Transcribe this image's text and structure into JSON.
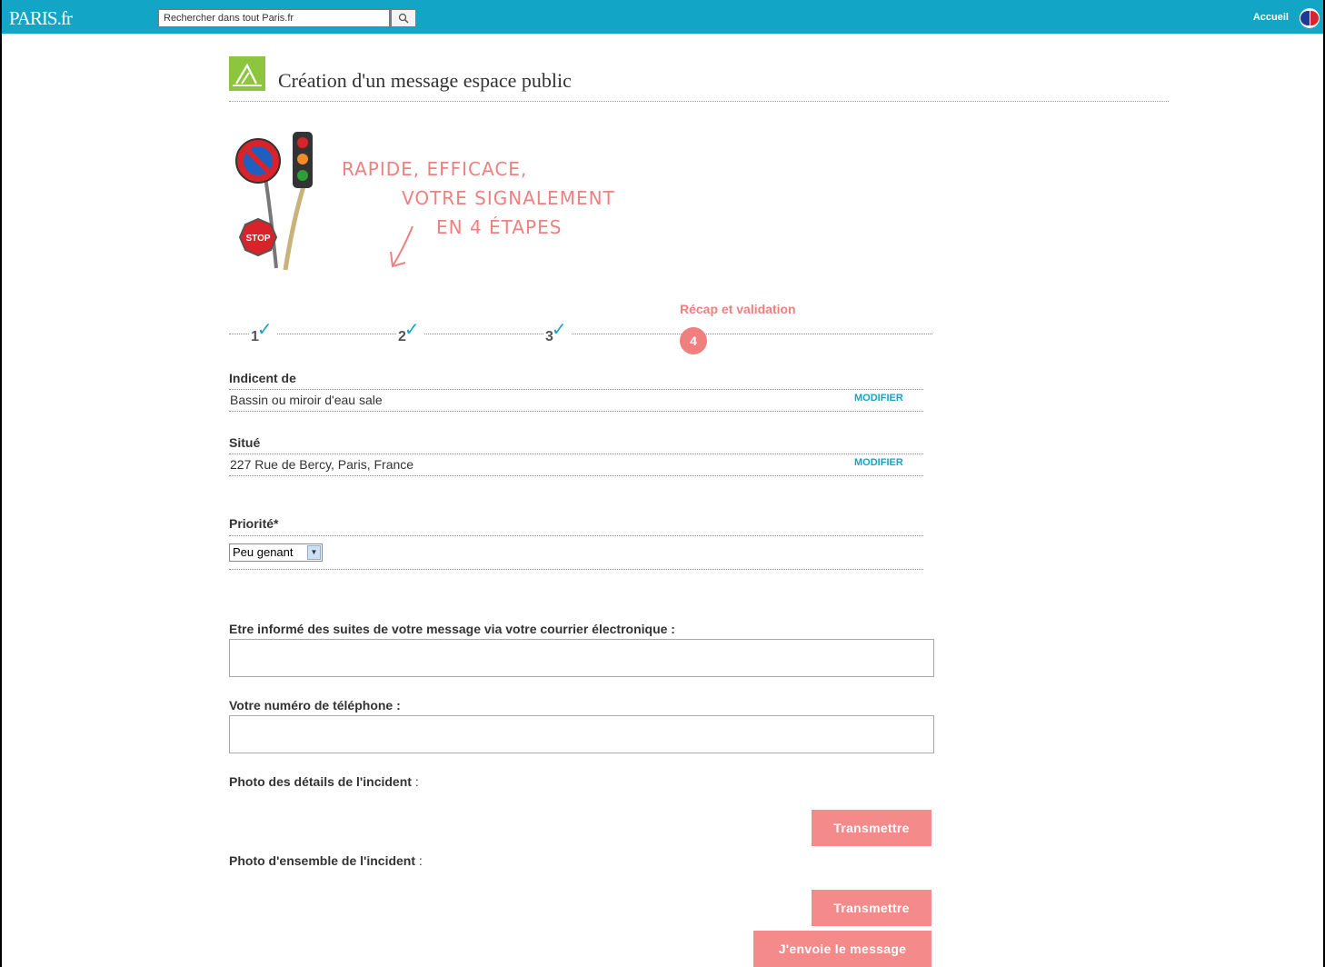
{
  "topbar": {
    "logo": "PARIS.fr",
    "search_placeholder": "Rechercher dans tout Paris.fr",
    "search_icon": "search-icon",
    "home_label": "Accueil",
    "colors": {
      "bar": "#13a5c6"
    }
  },
  "header": {
    "title": "Création d'un message espace public"
  },
  "tagline": {
    "line1": "RAPIDE, EFFICACE,",
    "line2": "VOTRE SIGNALEMENT",
    "line3": "EN 4 ÉTAPES"
  },
  "steps": {
    "items": [
      "1",
      "2",
      "3"
    ],
    "current_number": "4",
    "current_label": "Récap et validation",
    "colors": {
      "done_check": "#13a5c6",
      "current": "#f08080"
    }
  },
  "recap": {
    "incident_label": "Indicent de",
    "incident_value": "Bassin ou miroir d'eau sale",
    "location_label": "Situé",
    "location_value": "227 Rue de Bercy, Paris, France",
    "modify_label": "MODIFIER"
  },
  "priority": {
    "label": "Priorité*",
    "selected": "Peu genant"
  },
  "contact": {
    "email_label": "Etre informé des suites de votre message via votre courrier électronique :",
    "email_value": "",
    "phone_label": "Votre numéro de téléphone :",
    "phone_value": ""
  },
  "photos": {
    "detail_label": "Photo des détails de l'incident",
    "overview_label": "Photo d'ensemble de l'incident",
    "colon": ":",
    "transmit_label": "Transmettre"
  },
  "submit": {
    "label": "J'envoie le message",
    "color": "#f48a8a"
  }
}
